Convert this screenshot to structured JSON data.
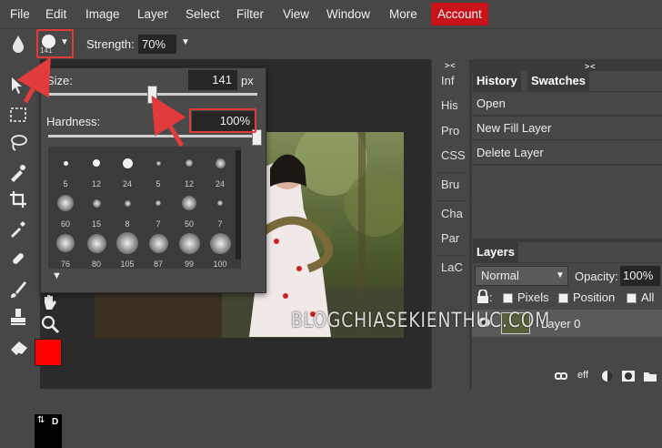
{
  "menu": {
    "items": [
      "File",
      "Edit",
      "Image",
      "Layer",
      "Select",
      "Filter",
      "View",
      "Window",
      "More"
    ],
    "account": "Account"
  },
  "options": {
    "brush_size_badge": "141",
    "strength_label": "Strength:",
    "strength_value": "70%"
  },
  "brush_popup": {
    "size_label": "Size:",
    "size_value": "141",
    "size_unit": "px",
    "size_fraction": 0.5,
    "hardness_label": "Hardness:",
    "hardness_value": "100%",
    "hardness_fraction": 1.0,
    "presets": [
      "5",
      "12",
      "24",
      "5",
      "12",
      "24",
      "60",
      "15",
      "8",
      "7",
      "50",
      "7",
      "76",
      "80",
      "105",
      "87",
      "99",
      "100"
    ]
  },
  "panel_strip": [
    "Inf",
    "His",
    "Pro",
    "CSS",
    "Bru",
    "Cha",
    "Par",
    "LaC"
  ],
  "history": {
    "tabs": [
      "History",
      "Swatches"
    ],
    "items": [
      "Open",
      "New Fill Layer",
      "Delete Layer"
    ]
  },
  "layers": {
    "tab": "Layers",
    "blend_mode": "Normal",
    "opacity_label": "Opacity:",
    "opacity_value": "100%",
    "lock_options": [
      "Pixels",
      "Position",
      "All"
    ],
    "layer_name": "Layer 0",
    "footer_eff": "eff"
  },
  "colors": {
    "foreground": "#ff0000",
    "background": "#000000",
    "accent": "#c9121a",
    "highlight": "#e23b3b"
  },
  "watermark": "BLOGCHIASEKIENTHUC.COM"
}
